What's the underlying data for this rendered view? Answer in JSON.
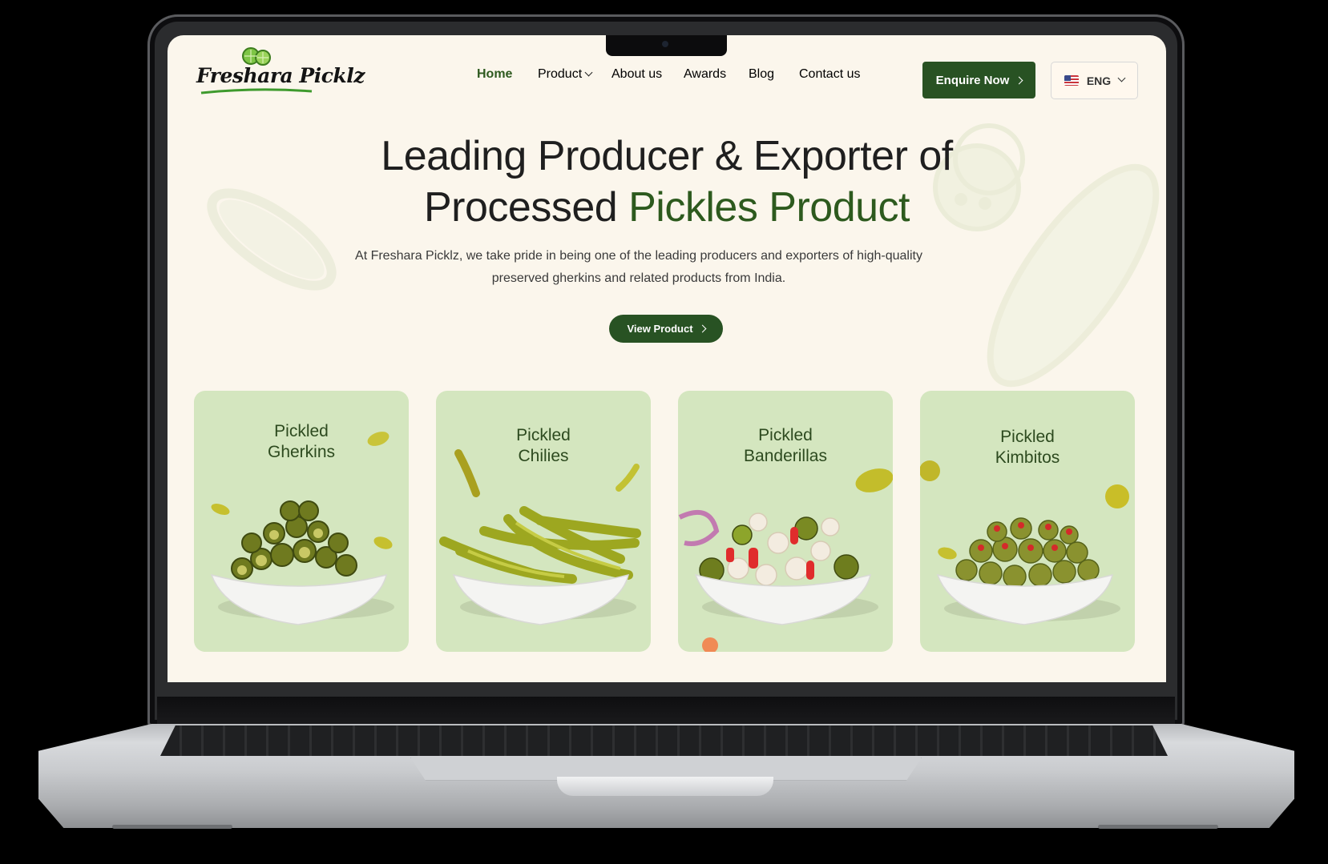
{
  "brand": {
    "logo_text": "Freshara Picklz"
  },
  "nav": {
    "items": [
      {
        "label": "Home",
        "active": true
      },
      {
        "label": "Product",
        "has_dropdown": true
      },
      {
        "label": "About us"
      },
      {
        "label": "Awards"
      },
      {
        "label": "Blog"
      },
      {
        "label": "Contact us"
      }
    ]
  },
  "header": {
    "enquire_label": "Enquire Now",
    "language": {
      "selected": "ENG",
      "flag_icon": "us-flag-icon"
    }
  },
  "hero": {
    "title_line1": "Leading Producer & Exporter of",
    "title_line2_plain": "Processed ",
    "title_line2_accent": "Pickles Product",
    "description": "At Freshara Picklz, we take pride in being one of the leading producers and exporters of high-quality preserved gherkins and related products from India.",
    "cta_label": "View Product"
  },
  "products": [
    {
      "title": "Pickled\nGherkins"
    },
    {
      "title": "Pickled\nChilies"
    },
    {
      "title": "Pickled\nBanderillas"
    },
    {
      "title": "Pickled\nKimbitos"
    }
  ],
  "colors": {
    "accent_green": "#285223",
    "page_background": "#fbf6ec",
    "card_background": "#d4e6bf"
  }
}
